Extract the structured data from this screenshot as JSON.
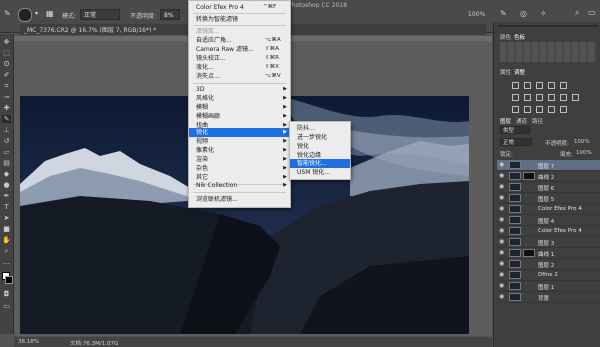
{
  "app": {
    "title": "Photoshop CC 2018"
  },
  "options_bar": {
    "mode_label": "模式:",
    "mode_value": "正常",
    "opacity_label": "不透明度:",
    "opacity_value": "8%",
    "percent": "100%"
  },
  "document": {
    "tab_title": "_MC_7376.CR2 @ 16.7% (图层 7, RGB/16*) *",
    "zoom": "38.18%",
    "doc_size": "文档:76.3M/1.07G"
  },
  "filter_menu": {
    "items": [
      {
        "label": "Color Efex Pro 4",
        "shortcut": "^⌘F"
      },
      {
        "label": "转换为智能滤镜"
      },
      {
        "label": "滤镜库...",
        "disabled": true
      },
      {
        "label": "自适应广角...",
        "shortcut": "⌥⌘A"
      },
      {
        "label": "Camera Raw 滤镜...",
        "shortcut": "⇧⌘A"
      },
      {
        "label": "镜头校正...",
        "shortcut": "⇧⌘R"
      },
      {
        "label": "液化...",
        "shortcut": "⇧⌘X"
      },
      {
        "label": "消失点...",
        "shortcut": "⌥⌘V"
      },
      {
        "label": "3D"
      },
      {
        "label": "风格化"
      },
      {
        "label": "模糊"
      },
      {
        "label": "模糊画廊"
      },
      {
        "label": "扭曲"
      },
      {
        "label": "锐化",
        "highlighted": true
      },
      {
        "label": "视频"
      },
      {
        "label": "像素化"
      },
      {
        "label": "渲染"
      },
      {
        "label": "杂色"
      },
      {
        "label": "其它"
      },
      {
        "label": "Nik Collection"
      },
      {
        "label": "浏览联机滤镜..."
      }
    ]
  },
  "sharpen_menu": {
    "items": [
      {
        "label": "防抖..."
      },
      {
        "label": "进一步锐化"
      },
      {
        "label": "锐化"
      },
      {
        "label": "锐化边缘"
      },
      {
        "label": "智能锐化...",
        "highlighted": true
      },
      {
        "label": "USM 锐化..."
      }
    ]
  },
  "panels": {
    "top_tabs": [
      "颜色",
      "色板"
    ],
    "adjust_tabs": [
      "属性",
      "调整"
    ],
    "layer_tabs": [
      "图层",
      "通道",
      "路径"
    ],
    "kind_label": "类型",
    "blend_mode": "正常",
    "opacity_label": "不透明度:",
    "opacity_value": "100%",
    "lock_label": "锁定:",
    "fill_label": "填充:",
    "fill_value": "100%"
  },
  "layers": [
    {
      "name": "图层 7",
      "active": true
    },
    {
      "name": "曲线 2",
      "mask": true
    },
    {
      "name": "图层 6"
    },
    {
      "name": "图层 5"
    },
    {
      "name": "Color Efex Pro 4"
    },
    {
      "name": "图层 4"
    },
    {
      "name": "Color Efex Pro 4"
    },
    {
      "name": "图层 3"
    },
    {
      "name": "曲线 1",
      "mask": true
    },
    {
      "name": "图层 2"
    },
    {
      "name": "Dfine 2"
    },
    {
      "name": "图层 1"
    },
    {
      "name": "背景"
    }
  ],
  "colors": {
    "menu_highlight": "#1f6fe0",
    "menu_bg": "#ececec",
    "chrome": "#4a4a4a"
  }
}
